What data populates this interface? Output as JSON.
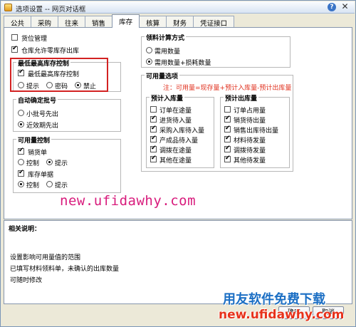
{
  "window": {
    "title": "选项设置 -- 网页对话框",
    "help": "?",
    "close": "✕"
  },
  "tabs": [
    {
      "label": "公共"
    },
    {
      "label": "采购"
    },
    {
      "label": "往来"
    },
    {
      "label": "销售"
    },
    {
      "label": "库存",
      "active": true
    },
    {
      "label": "核算"
    },
    {
      "label": "财务"
    },
    {
      "label": "凭证接口"
    }
  ],
  "left": {
    "cargo": "货位管理",
    "zero_out": "仓库允许零库存出库",
    "min_stock": {
      "title": "最低最高库存控制",
      "check": "最低最高库存控制",
      "options": [
        "提示",
        "密码",
        "禁止"
      ]
    },
    "batch": {
      "title": "自动确定批号",
      "options": [
        "小批号先出",
        "近效期先出"
      ]
    },
    "available": {
      "title": "可用量控制",
      "sales": "销货单",
      "sales_opts": [
        "控制",
        "提示"
      ],
      "stock": "库存单据",
      "stock_opts": [
        "控制",
        "提示"
      ]
    }
  },
  "right": {
    "material": {
      "title": "领料计算方式",
      "options": [
        "需用数量",
        "需用数量+损耗数量"
      ]
    },
    "avail": {
      "title": "可用量选项",
      "note": "注：可用量=现存量+预计入库量-预计出库量",
      "in_title": "预计入库量",
      "in_items": [
        "订单在途量",
        "进货待入量",
        "采购入库待入量",
        "产成品待入量",
        "调拨在途量",
        "其他在途量"
      ],
      "out_title": "预计出库量",
      "out_items": [
        "订单占用量",
        "销货待出量",
        "销售出库待出量",
        "材料待发量",
        "调拨待发量",
        "其他待发量"
      ]
    }
  },
  "watermark": "new.ufidawhy.com",
  "description": {
    "title": "相关说明：",
    "lines": [
      "设置影响可用量值的范围",
      "已填写材料领料单，未确认的出库数量",
      "可随时修改"
    ]
  },
  "buttons": {
    "ok": "确定",
    "cancel": "取消"
  },
  "brand": {
    "line1": "用友软件免费下载",
    "line2": "new.ufidawhy.com"
  }
}
